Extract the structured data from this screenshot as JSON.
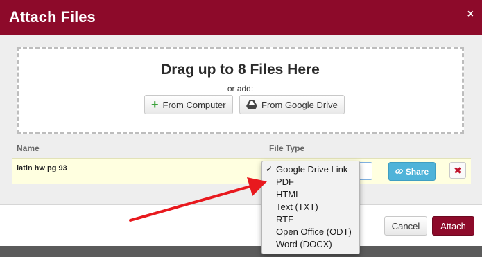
{
  "dialog": {
    "title": "Attach Files",
    "close_label": "×"
  },
  "dropzone": {
    "heading": "Drag up to 8 Files Here",
    "subtext": "or add:",
    "from_computer_label": "From Computer",
    "from_drive_label": "From Google Drive"
  },
  "table": {
    "headers": {
      "name": "Name",
      "file_type": "File Type"
    },
    "rows": [
      {
        "name": "latin hw pg 93",
        "share_label": "Share",
        "delete_label": "✖"
      }
    ]
  },
  "file_type_menu": {
    "check_mark": "✓",
    "selected_index": 0,
    "options": [
      "Google Drive Link",
      "PDF",
      "HTML",
      "Text (TXT)",
      "RTF",
      "Open Office (ODT)",
      "Word (DOCX)"
    ]
  },
  "footer": {
    "cancel_label": "Cancel",
    "attach_label": "Attach"
  },
  "colors": {
    "brand": "#8d0a2a",
    "share": "#4fb3d9",
    "highlight_row": "#ffffe0",
    "annotation_arrow": "#e8191e"
  }
}
